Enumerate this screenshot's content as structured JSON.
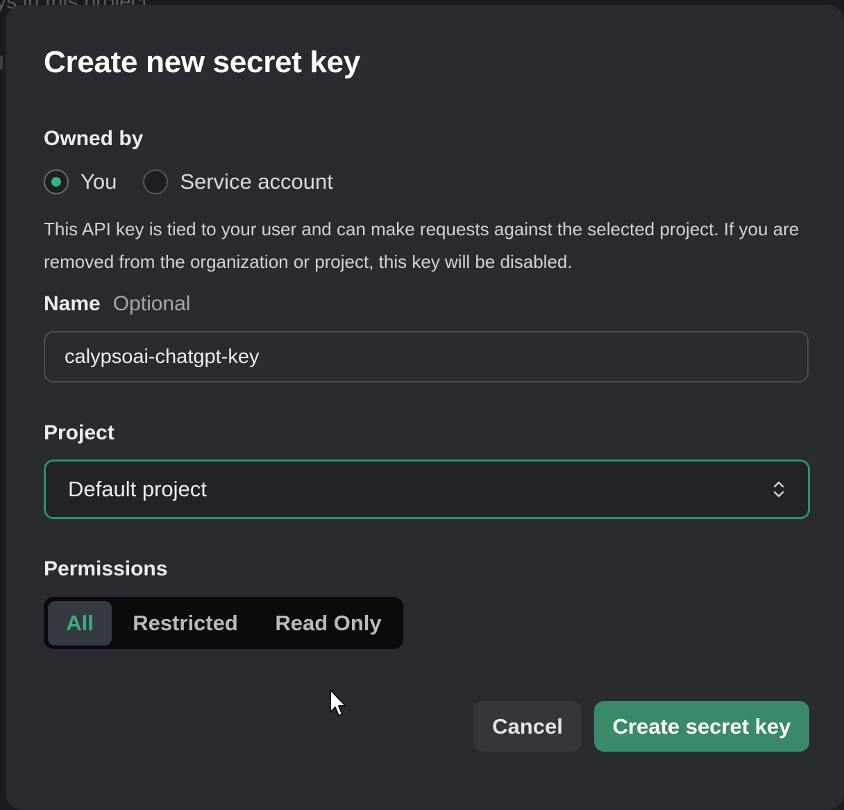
{
  "background": {
    "partial_text": "ys in this project"
  },
  "modal": {
    "title": "Create new secret key",
    "owned_by": {
      "label": "Owned by",
      "options": [
        {
          "label": "You",
          "checked": true
        },
        {
          "label": "Service account",
          "checked": false
        }
      ],
      "description": "This API key is tied to your user and can make requests against the selected project. If you are removed from the organization or project, this key will be disabled."
    },
    "name": {
      "label": "Name",
      "optional_label": "Optional",
      "value": "calypsoai-chatgpt-key"
    },
    "project": {
      "label": "Project",
      "selected": "Default project"
    },
    "permissions": {
      "label": "Permissions",
      "options": [
        "All",
        "Restricted",
        "Read Only"
      ],
      "selected": "All"
    },
    "buttons": {
      "cancel": "Cancel",
      "create": "Create secret key"
    }
  },
  "colors": {
    "accent": "#3fae80",
    "primary_button": "#3a8a69",
    "modal_bg": "#2a2b30"
  },
  "icons": {
    "select": "chevron-up-down-icon",
    "cursor": "mouse-pointer-icon"
  }
}
